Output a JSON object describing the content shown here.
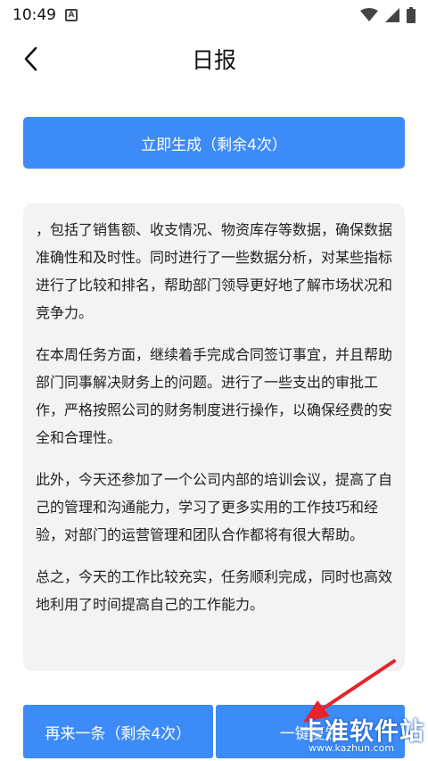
{
  "status_bar": {
    "time": "10:49",
    "notification_icon": "A"
  },
  "header": {
    "title": "日报"
  },
  "generate_button": "立即生成（剩余4次）",
  "report": {
    "paragraphs": [
      "，包括了销售额、收支情况、物资库存等数据，确保数据准确性和及时性。同时进行了一些数据分析，对某些指标进行了比较和排名，帮助部门领导更好地了解市场状况和竞争力。",
      "在本周任务方面，继续着手完成合同签订事宜，并且帮助部门同事解决财务上的问题。进行了一些支出的审批工作，严格按照公司的财务制度进行操作，以确保经费的安全和合理性。",
      "此外，今天还参加了一个公司内部的培训会议，提高了自己的管理和沟通能力，学习了更多实用的工作技巧和经验，对部门的运营管理和团队合作都将有很大帮助。",
      "总之，今天的工作比较充实，任务顺利完成，同时也高效地利用了时间提高自己的工作能力。"
    ]
  },
  "bottom": {
    "again_button": "再来一条（剩余4次）",
    "copy_button": "一键复制"
  },
  "watermark": {
    "brand": "卡准软件站",
    "url": "www.kazhun.com"
  },
  "colors": {
    "accent": "#3d8bf7",
    "card_bg": "#f3f3f4",
    "arrow": "#e8242b"
  }
}
